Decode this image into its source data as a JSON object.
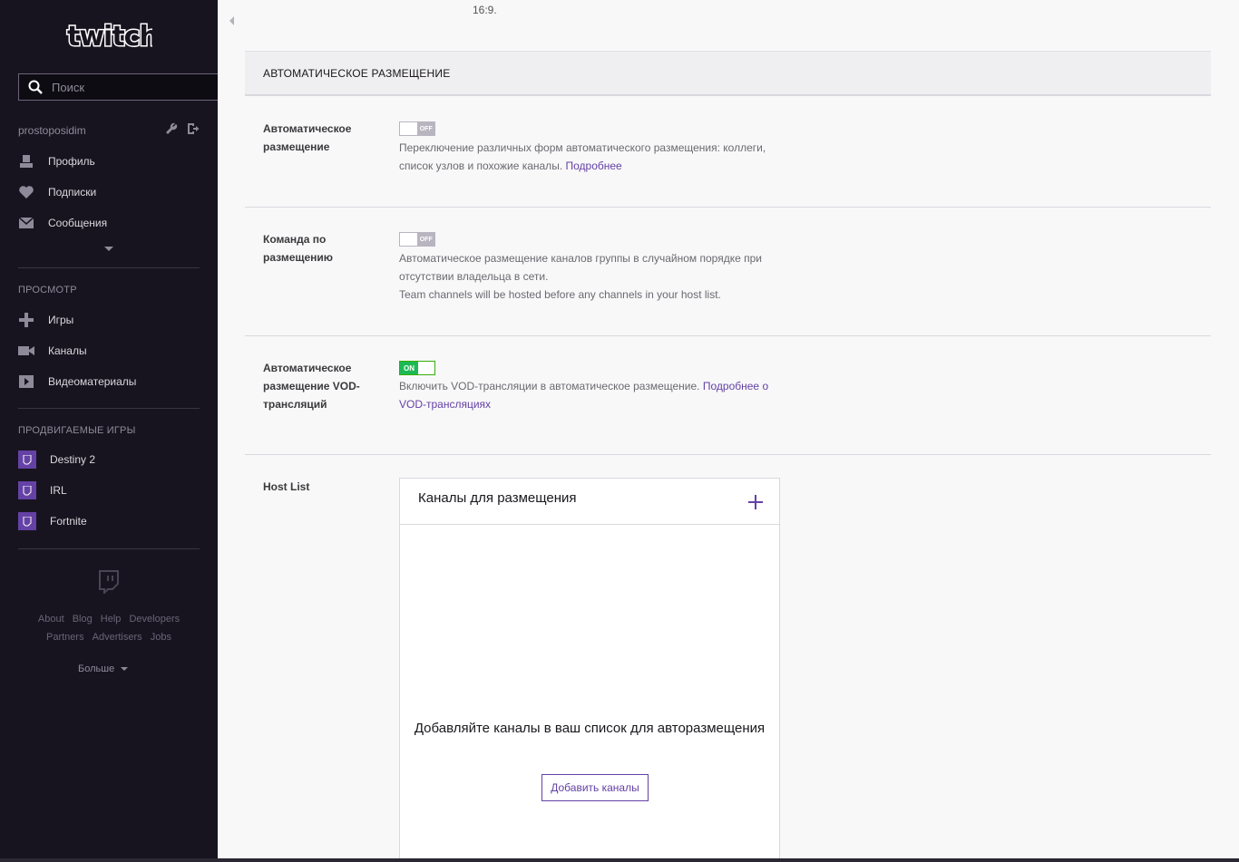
{
  "sidebar": {
    "logo_text": "twitch",
    "search_placeholder": "Поиск",
    "username": "prostoposidim",
    "nav": [
      {
        "label": "Профиль",
        "icon": "user-icon"
      },
      {
        "label": "Подписки",
        "icon": "heart-icon"
      },
      {
        "label": "Сообщения",
        "icon": "envelope-icon"
      }
    ],
    "browse_title": "ПРОСМОТР",
    "browse": [
      {
        "label": "Игры",
        "icon": "gamepad-icon"
      },
      {
        "label": "Каналы",
        "icon": "camera-icon"
      },
      {
        "label": "Видеоматериалы",
        "icon": "play-icon"
      }
    ],
    "promoted_title": "ПРОДВИГАЕМЫЕ ИГРЫ",
    "promoted": [
      {
        "label": "Destiny 2"
      },
      {
        "label": "IRL"
      },
      {
        "label": "Fortnite"
      }
    ],
    "footer_row1": [
      "About",
      "Blog",
      "Help",
      "Developers"
    ],
    "footer_row2": [
      "Partners",
      "Advertisers",
      "Jobs"
    ],
    "more_label": "Больше"
  },
  "main": {
    "ratio_text": "16:9.",
    "section_title": "АВТОМАТИЧЕСКОЕ РАЗМЕЩЕНИЕ",
    "settings": [
      {
        "label": "Автоматическое размещение",
        "toggle": "OFF",
        "desc": "Переключение различных форм автоматического размещения: коллеги, список узлов и похожие каналы.",
        "link": "Подробнее"
      },
      {
        "label": "Команда по размещению",
        "toggle": "OFF",
        "desc": "Автоматическое размещение каналов группы в случайном порядке при отсутствии владельца в сети.",
        "desc2": "Team channels will be hosted before any channels in your host list."
      },
      {
        "label": "Автоматическое размещение VOD-трансляций",
        "toggle": "ON",
        "desc": "Включить VOD-трансляции в автоматическое размещение.",
        "link": "Подробнее о VOD-трансляциях"
      }
    ],
    "host_list_label": "Host List",
    "host_box_title": "Каналы для размещения",
    "empty_text": "Добавляйте каналы в ваш список для авторазмещения",
    "add_button": "Добавить каналы"
  },
  "colors": {
    "sidebar_bg": "#17141f",
    "accent": "#6441a5",
    "toggle_on": "#1db954"
  }
}
